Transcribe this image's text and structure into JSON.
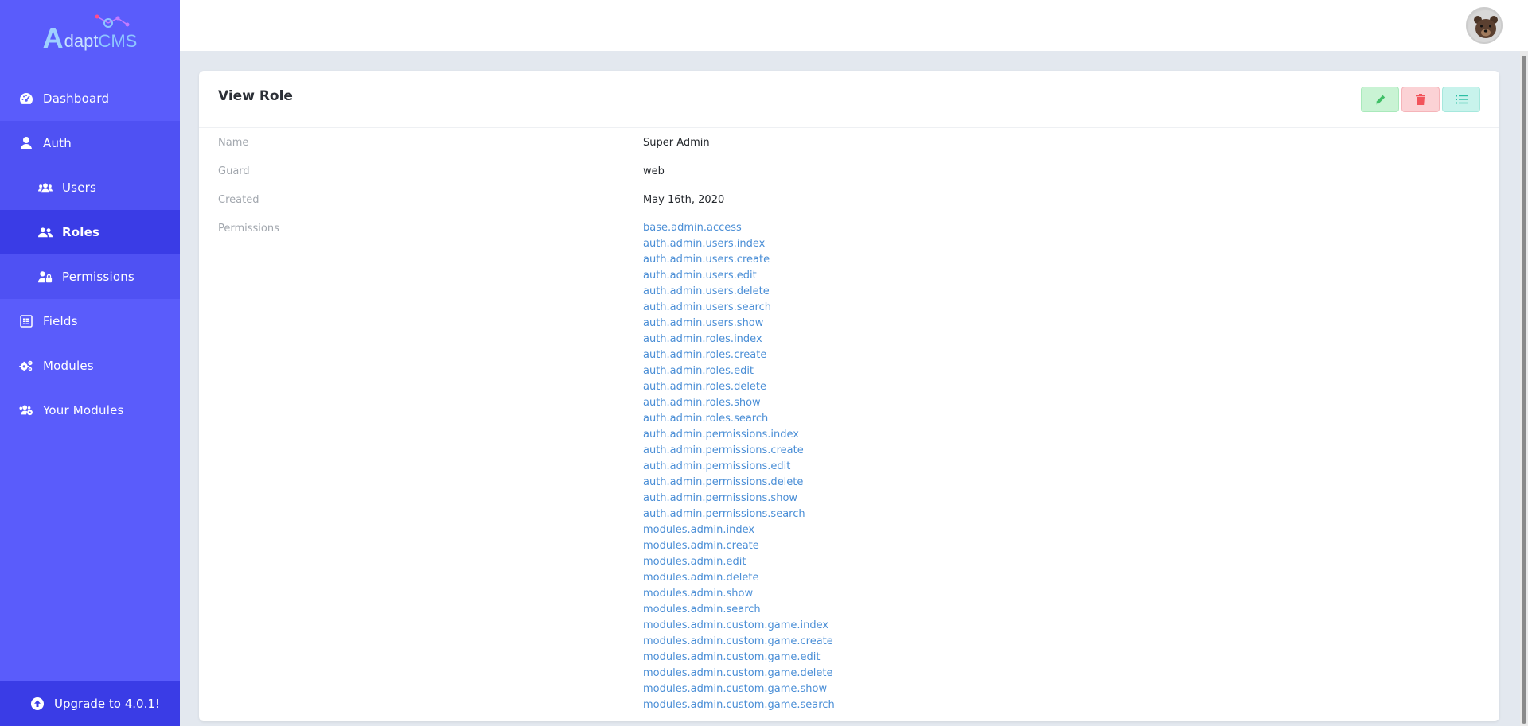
{
  "brand": {
    "logo_a": "A",
    "logo_rest": "dapt",
    "logo_cms": "CMS"
  },
  "sidebar": {
    "items": [
      {
        "label": "Dashboard",
        "icon": "gauge-icon"
      },
      {
        "label": "Auth",
        "icon": "user-icon"
      },
      {
        "label": "Users",
        "icon": "users-icon"
      },
      {
        "label": "Roles",
        "icon": "user-group-icon"
      },
      {
        "label": "Permissions",
        "icon": "user-lock-icon"
      },
      {
        "label": "Fields",
        "icon": "list-alt-icon"
      },
      {
        "label": "Modules",
        "icon": "cogs-icon"
      },
      {
        "label": "Your Modules",
        "icon": "users-cog-icon"
      }
    ],
    "upgrade_label": "Upgrade to 4.0.1!"
  },
  "card": {
    "title": "View Role",
    "fields": {
      "name": {
        "label": "Name",
        "value": "Super Admin"
      },
      "guard": {
        "label": "Guard",
        "value": "web"
      },
      "created": {
        "label": "Created",
        "value": "May 16th, 2020"
      },
      "permissions_label": "Permissions"
    },
    "permissions": [
      "base.admin.access",
      "auth.admin.users.index",
      "auth.admin.users.create",
      "auth.admin.users.edit",
      "auth.admin.users.delete",
      "auth.admin.users.search",
      "auth.admin.users.show",
      "auth.admin.roles.index",
      "auth.admin.roles.create",
      "auth.admin.roles.edit",
      "auth.admin.roles.delete",
      "auth.admin.roles.show",
      "auth.admin.roles.search",
      "auth.admin.permissions.index",
      "auth.admin.permissions.create",
      "auth.admin.permissions.edit",
      "auth.admin.permissions.delete",
      "auth.admin.permissions.show",
      "auth.admin.permissions.search",
      "modules.admin.index",
      "modules.admin.create",
      "modules.admin.edit",
      "modules.admin.delete",
      "modules.admin.show",
      "modules.admin.search",
      "modules.admin.custom.game.index",
      "modules.admin.custom.game.create",
      "modules.admin.custom.game.edit",
      "modules.admin.custom.game.delete",
      "modules.admin.custom.game.show",
      "modules.admin.custom.game.search"
    ]
  },
  "colors": {
    "sidebar": "#5a5cfb",
    "sidebar_active": "#3a3ce6",
    "link": "#4a8ed6",
    "edit": "#c9f3d4",
    "delete": "#fbd2d5",
    "list": "#c8f3ec"
  }
}
